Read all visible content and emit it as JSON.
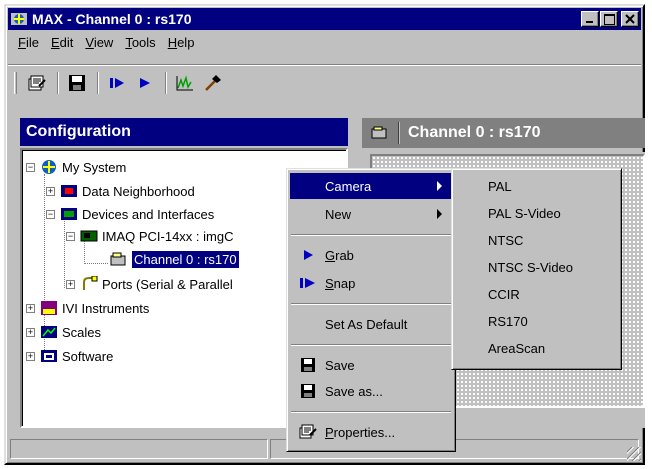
{
  "window": {
    "title": "MAX - Channel 0 : rs170"
  },
  "menubar": [
    {
      "label": "File",
      "underline": "F",
      "rest": "ile"
    },
    {
      "label": "Edit",
      "underline": "E",
      "rest": "dit"
    },
    {
      "label": "View",
      "underline": "V",
      "rest": "iew"
    },
    {
      "label": "Tools",
      "underline": "T",
      "rest": "ools"
    },
    {
      "label": "Help",
      "underline": "H",
      "rest": "elp"
    }
  ],
  "toolbar": {
    "icons": [
      "properties-icon",
      "save-icon",
      "snap-icon",
      "grab-icon",
      "histogram-icon",
      "tools-hammer-icon"
    ]
  },
  "left_panel": {
    "title": "Configuration"
  },
  "right_panel": {
    "title": "Channel 0 : rs170"
  },
  "tree": {
    "my_system": "My System",
    "data_neighborhood": "Data Neighborhood",
    "devices_and_interfaces": "Devices and Interfaces",
    "imaq_pci": "IMAQ PCI-14xx : imgC",
    "channel0": "Channel 0 : rs170",
    "ports": "Ports (Serial & Parallel",
    "ivi": "IVI Instruments",
    "scales": "Scales",
    "software": "Software"
  },
  "context_menu": {
    "camera": "Camera",
    "new": "New",
    "grab_u": "G",
    "grab_rest": "rab",
    "snap_u": "S",
    "snap_rest": "nap",
    "set_default": "Set As Default",
    "save": "Save",
    "save_as": "Save as...",
    "properties_u": "P",
    "properties_rest": "roperties..."
  },
  "camera_submenu": [
    "PAL",
    "PAL S-Video",
    "NTSC",
    "NTSC S-Video",
    "CCIR",
    "RS170",
    "AreaScan"
  ],
  "colors": {
    "title_active": "#000080",
    "face": "#c0c0c0",
    "highlight": "#000080"
  }
}
